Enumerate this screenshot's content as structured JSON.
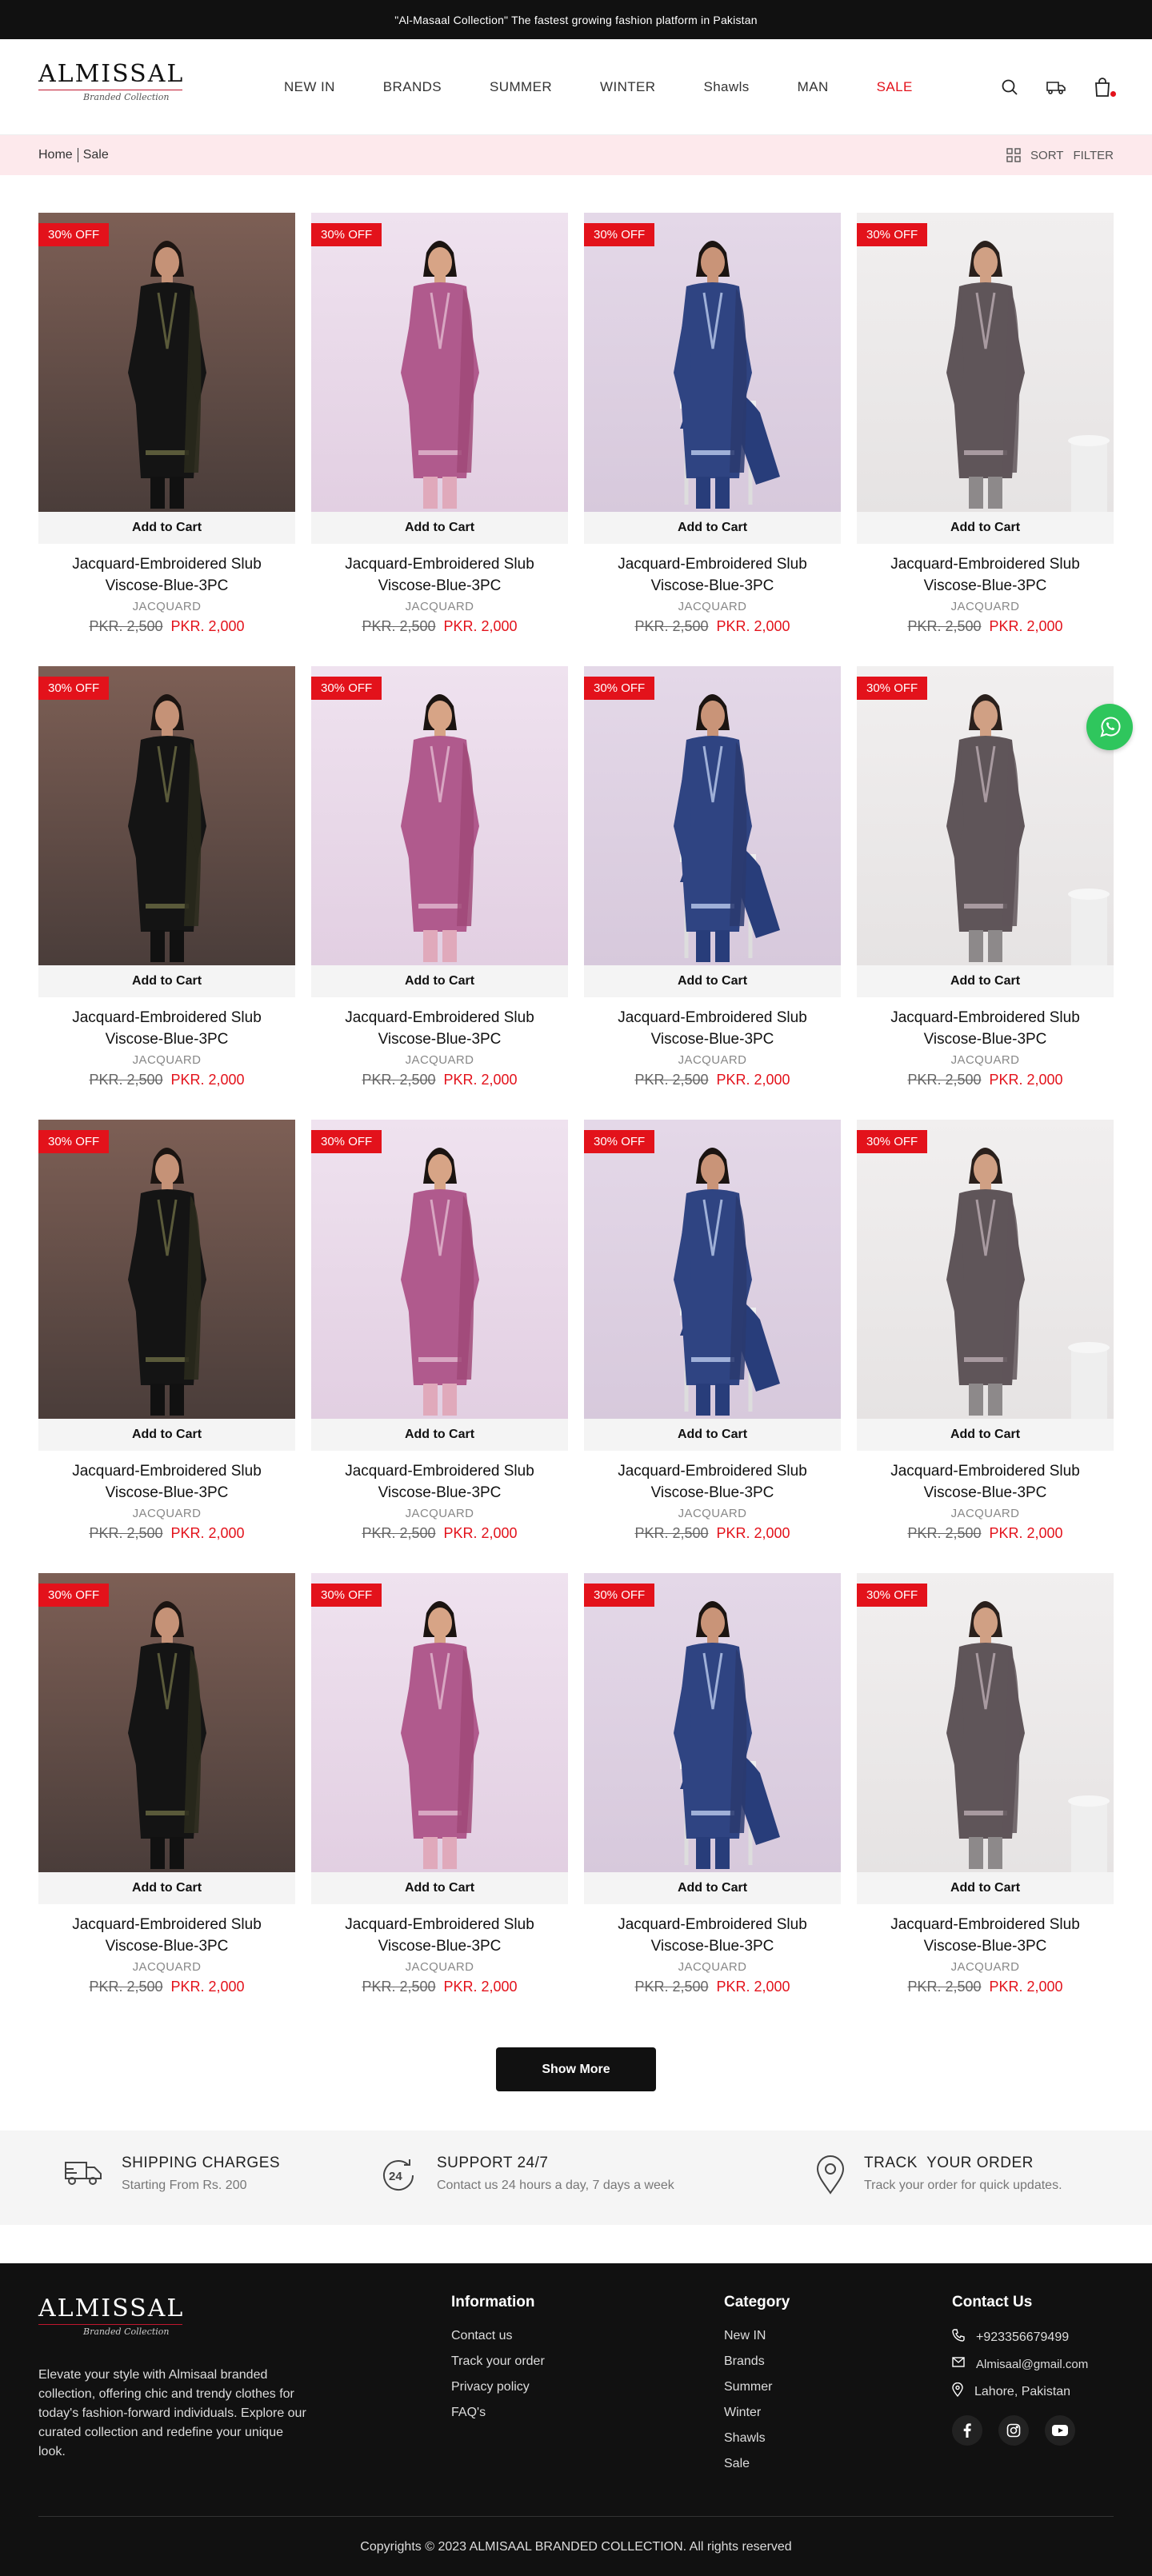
{
  "announcement": "\"Al-Masaal Collection\" The fastest growing fashion platform in Pakistan",
  "logo": {
    "name": "ALMISSAL",
    "tagline": "Branded Collection"
  },
  "nav": [
    "NEW IN",
    "BRANDS",
    "SUMMER",
    "WINTER",
    "Shawls",
    "MAN",
    "SALE"
  ],
  "breadcrumb": {
    "home": "Home",
    "current": "Sale",
    "sort": "SORT",
    "filter": "FILTER"
  },
  "products": [
    {
      "badge": "30% OFF",
      "cart": "Add to Cart",
      "name": "Jacquard-Embroidered Slub Viscose-Blue-3PC",
      "brand": "JACQUARD",
      "old_price": "PKR. 2,500",
      "new_price": "PKR. 2,000",
      "variant": "black"
    },
    {
      "badge": "30% OFF",
      "cart": "Add to Cart",
      "name": "Jacquard-Embroidered Slub Viscose-Blue-3PC",
      "brand": "JACQUARD",
      "old_price": "PKR. 2,500",
      "new_price": "PKR. 2,000",
      "variant": "pink"
    },
    {
      "badge": "30% OFF",
      "cart": "Add to Cart",
      "name": "Jacquard-Embroidered Slub Viscose-Blue-3PC",
      "brand": "JACQUARD",
      "old_price": "PKR. 2,500",
      "new_price": "PKR. 2,000",
      "variant": "blue"
    },
    {
      "badge": "30% OFF",
      "cart": "Add to Cart",
      "name": "Jacquard-Embroidered Slub Viscose-Blue-3PC",
      "brand": "JACQUARD",
      "old_price": "PKR. 2,500",
      "new_price": "PKR. 2,000",
      "variant": "grey"
    },
    {
      "badge": "30% OFF",
      "cart": "Add to Cart",
      "name": "Jacquard-Embroidered Slub Viscose-Blue-3PC",
      "brand": "JACQUARD",
      "old_price": "PKR. 2,500",
      "new_price": "PKR. 2,000",
      "variant": "black"
    },
    {
      "badge": "30% OFF",
      "cart": "Add to Cart",
      "name": "Jacquard-Embroidered Slub Viscose-Blue-3PC",
      "brand": "JACQUARD",
      "old_price": "PKR. 2,500",
      "new_price": "PKR. 2,000",
      "variant": "pink"
    },
    {
      "badge": "30% OFF",
      "cart": "Add to Cart",
      "name": "Jacquard-Embroidered Slub Viscose-Blue-3PC",
      "brand": "JACQUARD",
      "old_price": "PKR. 2,500",
      "new_price": "PKR. 2,000",
      "variant": "blue"
    },
    {
      "badge": "30% OFF",
      "cart": "Add to Cart",
      "name": "Jacquard-Embroidered Slub Viscose-Blue-3PC",
      "brand": "JACQUARD",
      "old_price": "PKR. 2,500",
      "new_price": "PKR. 2,000",
      "variant": "grey"
    },
    {
      "badge": "30% OFF",
      "cart": "Add to Cart",
      "name": "Jacquard-Embroidered Slub Viscose-Blue-3PC",
      "brand": "JACQUARD",
      "old_price": "PKR. 2,500",
      "new_price": "PKR. 2,000",
      "variant": "black"
    },
    {
      "badge": "30% OFF",
      "cart": "Add to Cart",
      "name": "Jacquard-Embroidered Slub Viscose-Blue-3PC",
      "brand": "JACQUARD",
      "old_price": "PKR. 2,500",
      "new_price": "PKR. 2,000",
      "variant": "pink"
    },
    {
      "badge": "30% OFF",
      "cart": "Add to Cart",
      "name": "Jacquard-Embroidered Slub Viscose-Blue-3PC",
      "brand": "JACQUARD",
      "old_price": "PKR. 2,500",
      "new_price": "PKR. 2,000",
      "variant": "blue"
    },
    {
      "badge": "30% OFF",
      "cart": "Add to Cart",
      "name": "Jacquard-Embroidered Slub Viscose-Blue-3PC",
      "brand": "JACQUARD",
      "old_price": "PKR. 2,500",
      "new_price": "PKR. 2,000",
      "variant": "grey"
    },
    {
      "badge": "30% OFF",
      "cart": "Add to Cart",
      "name": "Jacquard-Embroidered Slub Viscose-Blue-3PC",
      "brand": "JACQUARD",
      "old_price": "PKR. 2,500",
      "new_price": "PKR. 2,000",
      "variant": "black"
    },
    {
      "badge": "30% OFF",
      "cart": "Add to Cart",
      "name": "Jacquard-Embroidered Slub Viscose-Blue-3PC",
      "brand": "JACQUARD",
      "old_price": "PKR. 2,500",
      "new_price": "PKR. 2,000",
      "variant": "pink"
    },
    {
      "badge": "30% OFF",
      "cart": "Add to Cart",
      "name": "Jacquard-Embroidered Slub Viscose-Blue-3PC",
      "brand": "JACQUARD",
      "old_price": "PKR. 2,500",
      "new_price": "PKR. 2,000",
      "variant": "blue"
    },
    {
      "badge": "30% OFF",
      "cart": "Add to Cart",
      "name": "Jacquard-Embroidered Slub Viscose-Blue-3PC",
      "brand": "JACQUARD",
      "old_price": "PKR. 2,500",
      "new_price": "PKR. 2,000",
      "variant": "grey"
    }
  ],
  "show_more": "Show More",
  "features": [
    {
      "icon": "truck-icon",
      "title": "SHIPPING CHARGES",
      "sub": "Starting From Rs. 200"
    },
    {
      "icon": "support-24-icon",
      "title": "SUPPORT 24/7",
      "sub": "Contact us 24 hours a day, 7 days a week"
    },
    {
      "icon": "location-pin-icon",
      "title": "TRACK  YOUR ORDER",
      "sub": "Track your order for quick updates."
    }
  ],
  "footer": {
    "description": "Elevate your style with Almisaal branded collection, offering chic and trendy clothes for today's fashion-forward individuals. Explore our curated collection and redefine your unique look.",
    "information": {
      "title": "Information",
      "links": [
        "Contact us",
        "Track your order",
        "Privacy policy",
        "FAQ's"
      ]
    },
    "category": {
      "title": "Category",
      "links": [
        "New IN",
        "Brands",
        "Summer",
        "Winter",
        "Shawls",
        "Sale"
      ]
    },
    "contact": {
      "title": "Contact Us",
      "phone": "+923356679499",
      "email": "Almisaal@gmail.com",
      "address": "Lahore, Pakistan"
    },
    "copyright": "Copyrights © 2023 ALMISAAL BRANDED COLLECTION. All rights reserved"
  },
  "colors": {
    "accent": "#e3121b",
    "dark": "#111111",
    "breadcrumb_bg": "#fde9ec",
    "whatsapp": "#2fc65d"
  }
}
